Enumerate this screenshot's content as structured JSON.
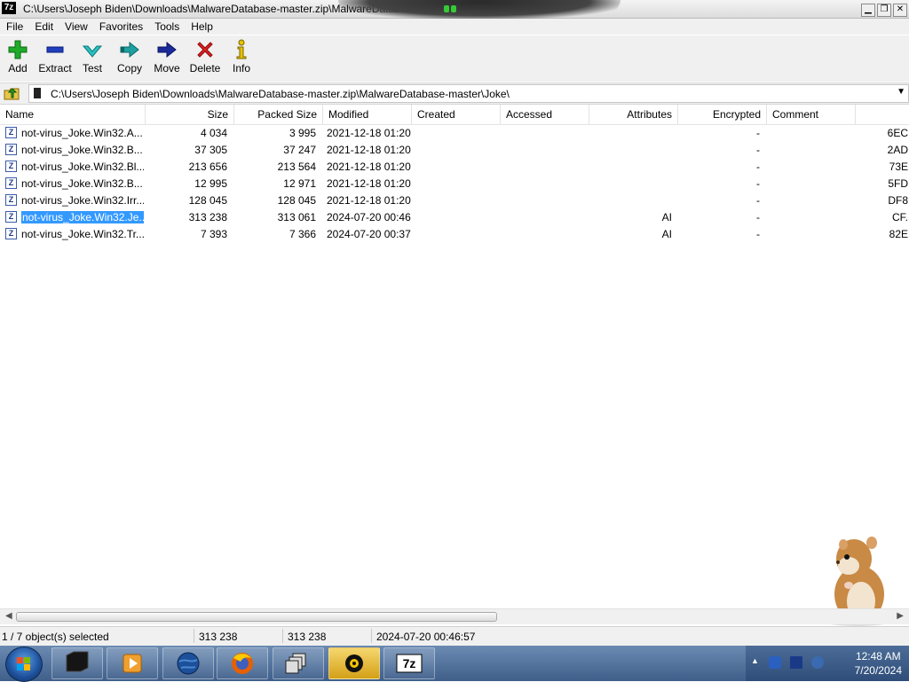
{
  "window": {
    "title": "C:\\Users\\Joseph Biden\\Downloads\\MalwareDatabase-master.zip\\MalwareDatabase-master\\Joke\\",
    "app_icon_text": "7z"
  },
  "menu": [
    "File",
    "Edit",
    "View",
    "Favorites",
    "Tools",
    "Help"
  ],
  "toolbar": [
    {
      "label": "Add",
      "icon": "plus-icon"
    },
    {
      "label": "Extract",
      "icon": "minus-icon"
    },
    {
      "label": "Test",
      "icon": "checkmark-icon"
    },
    {
      "label": "Copy",
      "icon": "double-arrow-icon"
    },
    {
      "label": "Move",
      "icon": "arrow-right-icon"
    },
    {
      "label": "Delete",
      "icon": "x-icon"
    },
    {
      "label": "Info",
      "icon": "info-icon"
    }
  ],
  "address": {
    "path": "C:\\Users\\Joseph Biden\\Downloads\\MalwareDatabase-master.zip\\MalwareDatabase-master\\Joke\\"
  },
  "columns": [
    "Name",
    "Size",
    "Packed Size",
    "Modified",
    "Created",
    "Accessed",
    "Attributes",
    "Encrypted",
    "Comment"
  ],
  "files": [
    {
      "name": "not-virus_Joke.Win32.A...",
      "size": "4 034",
      "packed": "3 995",
      "modified": "2021-12-18 01:20",
      "attributes": "",
      "encrypted": "-",
      "crc": "6EC"
    },
    {
      "name": "not-virus_Joke.Win32.B...",
      "size": "37 305",
      "packed": "37 247",
      "modified": "2021-12-18 01:20",
      "attributes": "",
      "encrypted": "-",
      "crc": "2AD"
    },
    {
      "name": "not-virus_Joke.Win32.Bl...",
      "size": "213 656",
      "packed": "213 564",
      "modified": "2021-12-18 01:20",
      "attributes": "",
      "encrypted": "-",
      "crc": "73E"
    },
    {
      "name": "not-virus_Joke.Win32.B...",
      "size": "12 995",
      "packed": "12 971",
      "modified": "2021-12-18 01:20",
      "attributes": "",
      "encrypted": "-",
      "crc": "5FD"
    },
    {
      "name": "not-virus_Joke.Win32.Irr...",
      "size": "128 045",
      "packed": "128 045",
      "modified": "2021-12-18 01:20",
      "attributes": "",
      "encrypted": "-",
      "crc": "DF8"
    },
    {
      "name": "not-virus_Joke.Win32.Je...",
      "size": "313 238",
      "packed": "313 061",
      "modified": "2024-07-20 00:46",
      "attributes": "AI",
      "encrypted": "-",
      "crc": "CF."
    },
    {
      "name": "not-virus_Joke.Win32.Tr...",
      "size": "7 393",
      "packed": "7 366",
      "modified": "2024-07-20 00:37",
      "attributes": "AI",
      "encrypted": "-",
      "crc": "82E"
    }
  ],
  "selected_index": 5,
  "status": {
    "selection": "1 / 7 object(s) selected",
    "size": "313 238",
    "packed": "313 238",
    "modified": "2024-07-20 00:46:57"
  },
  "taskbar": {
    "items": [
      "terminal-app-icon",
      "media-player-icon",
      "globe-browser-icon",
      "firefox-icon",
      "window-stack-icon",
      "burner-app-icon",
      "7zip-icon"
    ],
    "active_index": 5,
    "clock_time": "12:48 AM",
    "clock_date": "7/20/2024"
  }
}
